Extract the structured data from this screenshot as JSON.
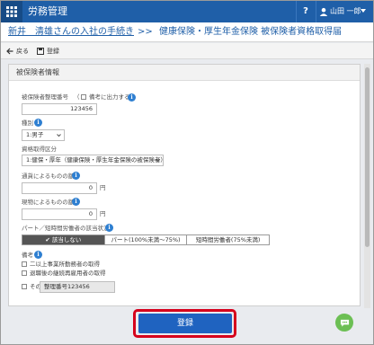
{
  "app": {
    "title": "労務管理"
  },
  "topbar": {
    "help_label": "?",
    "user_name": "山田 一郎"
  },
  "breadcrumb": {
    "link": "新井　清雄さんの入社の手続き",
    "separator": ">>",
    "current": "健康保険・厚生年金保険 被保険者資格取得届"
  },
  "toolbar": {
    "back_label": "戻る",
    "register_label": "登録"
  },
  "section": {
    "title": "被保険者情報"
  },
  "form": {
    "insured_number": {
      "label": "被保険者整理番号",
      "remark_label": "備考に出力する",
      "value": "123456"
    },
    "gender": {
      "label": "種別",
      "value": "1:男子"
    },
    "acquisition_type": {
      "label": "資格取得区分",
      "value": "1:健保・厚年（健康保険・厚生年金保険の被保険者）"
    },
    "currency_amount": {
      "label": "通貨によるものの額",
      "value": "0",
      "unit": "円"
    },
    "inkind_amount": {
      "label": "現物によるものの額",
      "value": "0",
      "unit": "円"
    },
    "part_time": {
      "label": "パート／短時間労働者の該当状況",
      "options": [
        "✔ 該当しない",
        "パート(100%未満〜75%)",
        "短時間労働者(75%未満)"
      ],
      "selected": 0
    },
    "remarks": {
      "label": "備考",
      "checks": [
        "二以上事業所勤務者の取得",
        "退職後の継続再雇用者の取得"
      ],
      "other_label": "その他",
      "other_value": "整理番号123456"
    }
  },
  "submit": {
    "label": "登録"
  },
  "colors": {
    "brand": "#1f5fa8",
    "submit": "#1f63c0",
    "highlight": "#d6001c",
    "chat": "#6cbf54"
  }
}
